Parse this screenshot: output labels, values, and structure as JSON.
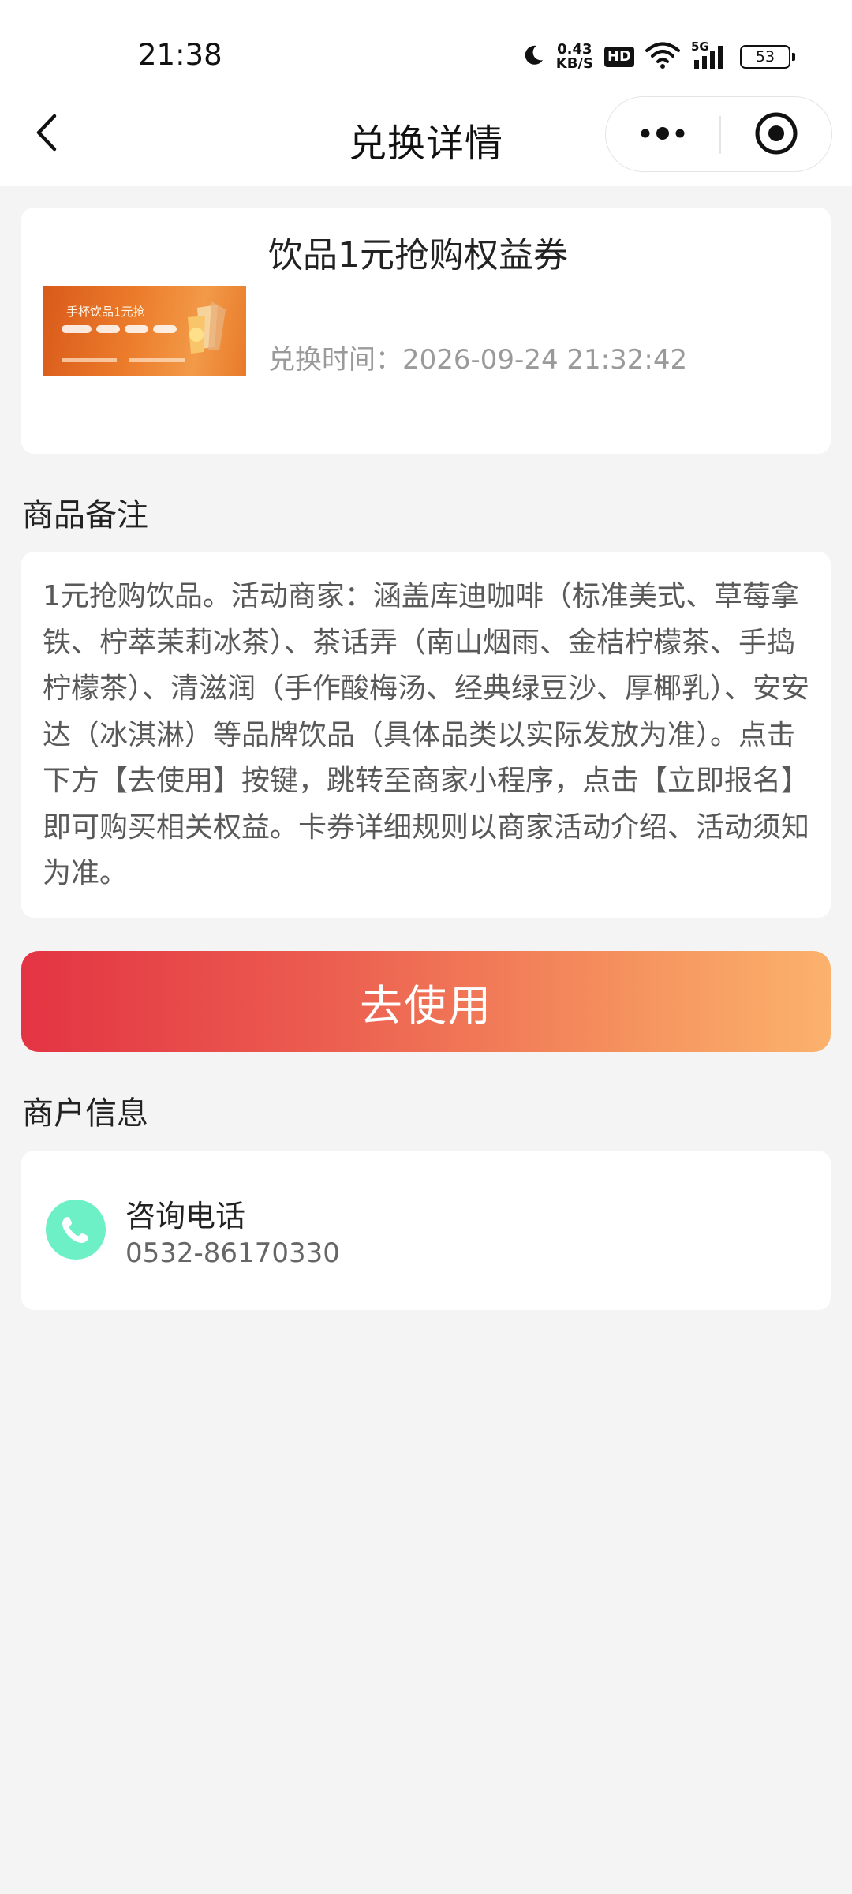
{
  "status_bar": {
    "time": "21:38",
    "net_speed_value": "0.43",
    "net_speed_unit": "KB/S",
    "hd": "HD",
    "network": "5G",
    "battery": "53",
    "icons": [
      "moon-icon",
      "wifi-icon",
      "signal-icon",
      "battery-icon"
    ]
  },
  "nav": {
    "title": "兑换详情",
    "icons": [
      "back-arrow-icon",
      "more-dots-icon",
      "target-close-icon"
    ]
  },
  "product": {
    "title": "饮品1元抢购权益券",
    "time": "兑换时间：2026-09-24 21:32:42",
    "thumbnail": {
      "headline": "手杯饮品1元抢",
      "colors": [
        "#d95a1a",
        "#f29a48"
      ]
    }
  },
  "note": {
    "label": "商品备注",
    "text": "1元抢购饮品。活动商家：涵盖库迪咖啡（标准美式、草莓拿铁、柠萃茉莉冰茶）、茶话弄（南山烟雨、金桔柠檬茶、手捣柠檬茶）、清滋润（手作酸梅汤、经典绿豆沙、厚椰乳）、安安达（冰淇淋）等品牌饮品（具体品类以实际发放为准）。点击下方【去使用】按键，跳转至商家小程序，点击【立即报名】即可购买相关权益。卡券详细规则以商家活动介绍、活动须知为准。"
  },
  "action": {
    "use_label": "去使用",
    "colors": [
      "#e33443",
      "#fbb26d"
    ]
  },
  "merchant": {
    "label": "商户信息",
    "contact_title": "咨询电话",
    "phone": "0532-86170330",
    "icon_color": "#6ef0c6"
  }
}
